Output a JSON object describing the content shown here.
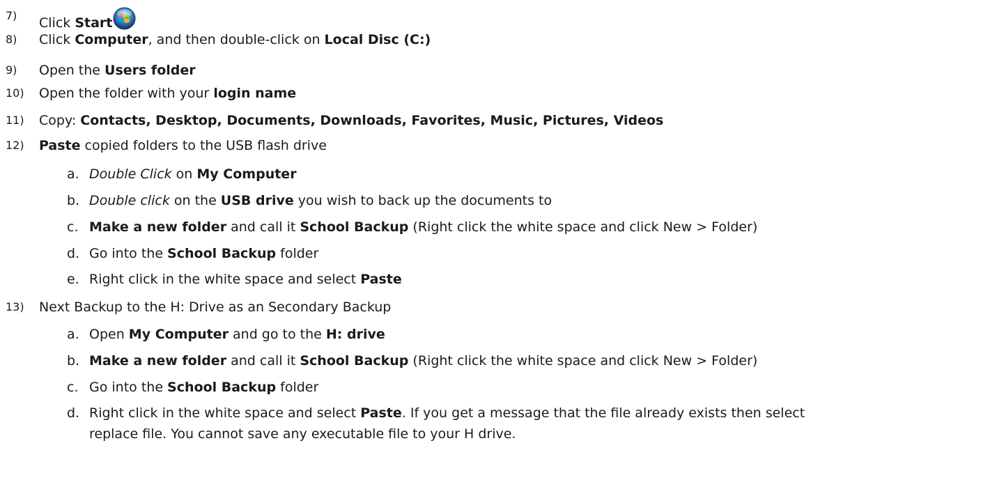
{
  "steps": [
    {
      "num": "7)",
      "parts": [
        {
          "t": "Click "
        },
        {
          "t": "Start",
          "b": true
        }
      ],
      "start_orb": true
    },
    {
      "num": "8)",
      "parts": [
        {
          "t": "Click "
        },
        {
          "t": "Computer",
          "b": true
        },
        {
          "t": ", and then double-click on "
        },
        {
          "t": "Local Disc (C:)",
          "b": true
        }
      ]
    },
    {
      "num": "9)",
      "parts": [
        {
          "t": "Open the "
        },
        {
          "t": "Users folder",
          "b": true
        }
      ]
    },
    {
      "num": "10)",
      "parts": [
        {
          "t": "Open the folder with your "
        },
        {
          "t": "login name",
          "b": true
        }
      ]
    },
    {
      "num": "11)",
      "parts": [
        {
          "t": "Copy:  "
        },
        {
          "t": "Contacts, Desktop, Documents, Downloads, Favorites, Music, Pictures, Videos",
          "b": true
        }
      ]
    },
    {
      "num": "12)",
      "parts": [
        {
          "t": "Paste",
          "b": true
        },
        {
          "t": " copied folders to the USB flash drive"
        }
      ],
      "subs": [
        {
          "lbl": "a.",
          "parts": [
            {
              "t": "Double Click",
              "i": true
            },
            {
              "t": " on "
            },
            {
              "t": "My Computer",
              "b": true
            }
          ]
        },
        {
          "lbl": "b.",
          "parts": [
            {
              "t": "Double click",
              "i": true
            },
            {
              "t": " on the "
            },
            {
              "t": "USB drive",
              "b": true
            },
            {
              "t": " you wish to back up the documents to"
            }
          ]
        },
        {
          "lbl": "c.",
          "parts": [
            {
              "t": "Make a new folder",
              "b": true
            },
            {
              "t": " and call it "
            },
            {
              "t": "School Backup",
              "b": true
            },
            {
              "t": " (Right click the white space and click New > Folder)"
            }
          ]
        },
        {
          "lbl": "d.",
          "parts": [
            {
              "t": "Go into the "
            },
            {
              "t": "School Backup",
              "b": true
            },
            {
              "t": " folder"
            }
          ]
        },
        {
          "lbl": "e.",
          "parts": [
            {
              "t": "Right click in the white space and select "
            },
            {
              "t": "Paste",
              "b": true
            }
          ]
        }
      ]
    },
    {
      "num": "13)",
      "parts": [
        {
          "t": "Next Backup to the H: Drive as an Secondary Backup"
        }
      ],
      "subs": [
        {
          "lbl": "a.",
          "parts": [
            {
              "t": "Open "
            },
            {
              "t": "My Computer",
              "b": true
            },
            {
              "t": " and go to the "
            },
            {
              "t": "H: drive",
              "b": true
            }
          ]
        },
        {
          "lbl": "b.",
          "parts": [
            {
              "t": "Make a new folder",
              "b": true
            },
            {
              "t": " and call it "
            },
            {
              "t": "School Backup",
              "b": true
            },
            {
              "t": " (Right click the white space and click New > Folder)"
            }
          ]
        },
        {
          "lbl": "c.",
          "parts": [
            {
              "t": "Go into the "
            },
            {
              "t": "School Backup",
              "b": true
            },
            {
              "t": " folder"
            }
          ]
        },
        {
          "lbl": "d.",
          "parts": [
            {
              "t": "Right click in the white space and select "
            },
            {
              "t": "Paste",
              "b": true
            },
            {
              "t": ".  If you get a message that the file already exists then select"
            }
          ]
        },
        {
          "lbl": "",
          "parts": [
            {
              "t": "replace file. You cannot save any executable file to your H drive."
            }
          ]
        }
      ]
    }
  ],
  "icons": {
    "start_orb": "windows-start-orb-icon"
  }
}
